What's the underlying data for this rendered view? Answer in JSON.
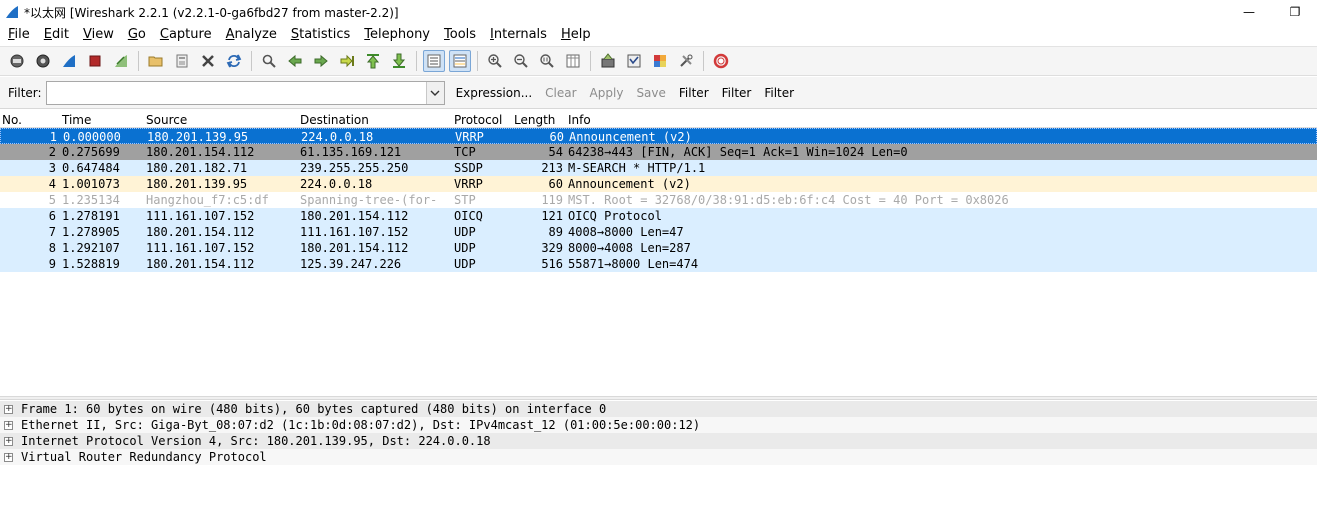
{
  "window": {
    "title": "*以太网 [Wireshark 2.2.1 (v2.2.1-0-ga6fbd27 from master-2.2)]",
    "minimize_glyph": "—",
    "restore_glyph": "❐"
  },
  "menu": [
    "File",
    "Edit",
    "View",
    "Go",
    "Capture",
    "Analyze",
    "Statistics",
    "Telephony",
    "Tools",
    "Internals",
    "Help"
  ],
  "toolbar": {
    "icons": [
      "interfaces-icon",
      "options-icon",
      "start-capture-icon",
      "stop-capture-icon",
      "restart-capture-icon",
      "open-file-icon",
      "save-file-icon",
      "close-file-icon",
      "reload-icon",
      "find-packet-icon",
      "go-back-icon",
      "go-forward-icon",
      "go-to-packet-icon",
      "first-packet-icon",
      "last-packet-icon",
      "autoscroll-icon",
      "colorize-icon",
      "zoom-in-icon",
      "zoom-out-icon",
      "zoom-normal-icon",
      "resize-columns-icon",
      "capture-filters-icon",
      "display-filters-icon",
      "coloring-rules-icon",
      "preferences-icon",
      "help-icon"
    ]
  },
  "filter": {
    "label": "Filter:",
    "value": "",
    "buttons": {
      "expression": "Expression...",
      "clear": "Clear",
      "apply": "Apply",
      "save": "Save",
      "filter1": "Filter",
      "filter2": "Filter",
      "filter3": "Filter"
    }
  },
  "packet_list": {
    "columns": [
      "No.",
      "Time",
      "Source",
      "Destination",
      "Protocol",
      "Length",
      "Info"
    ],
    "rows": [
      {
        "no": "1",
        "time": "0.000000",
        "src": "180.201.139.95",
        "dst": "224.0.0.18",
        "proto": "VRRP",
        "len": "60",
        "info": "Announcement (v2)"
      },
      {
        "no": "2",
        "time": "0.275699",
        "src": "180.201.154.112",
        "dst": "61.135.169.121",
        "proto": "TCP",
        "len": "54",
        "info": "64238→443 [FIN, ACK] Seq=1 Ack=1 Win=1024 Len=0"
      },
      {
        "no": "3",
        "time": "0.647484",
        "src": "180.201.182.71",
        "dst": "239.255.255.250",
        "proto": "SSDP",
        "len": "213",
        "info": "M-SEARCH * HTTP/1.1"
      },
      {
        "no": "4",
        "time": "1.001073",
        "src": "180.201.139.95",
        "dst": "224.0.0.18",
        "proto": "VRRP",
        "len": "60",
        "info": "Announcement (v2)"
      },
      {
        "no": "5",
        "time": "1.235134",
        "src": "Hangzhou_f7:c5:df",
        "dst": "Spanning-tree-(for-",
        "proto": "STP",
        "len": "119",
        "info": "MST. Root = 32768/0/38:91:d5:eb:6f:c4  Cost = 40  Port = 0x8026"
      },
      {
        "no": "6",
        "time": "1.278191",
        "src": "111.161.107.152",
        "dst": "180.201.154.112",
        "proto": "OICQ",
        "len": "121",
        "info": "OICQ Protocol"
      },
      {
        "no": "7",
        "time": "1.278905",
        "src": "180.201.154.112",
        "dst": "111.161.107.152",
        "proto": "UDP",
        "len": "89",
        "info": "4008→8000 Len=47"
      },
      {
        "no": "8",
        "time": "1.292107",
        "src": "111.161.107.152",
        "dst": "180.201.154.112",
        "proto": "UDP",
        "len": "329",
        "info": "8000→4008 Len=287"
      },
      {
        "no": "9",
        "time": "1.528819",
        "src": "180.201.154.112",
        "dst": "125.39.247.226",
        "proto": "UDP",
        "len": "516",
        "info": "55871→8000 Len=474"
      }
    ]
  },
  "packet_details": {
    "expander_glyph": "+",
    "rows": [
      "Frame 1: 60 bytes on wire (480 bits), 60 bytes captured (480 bits) on interface 0",
      "Ethernet II, Src: Giga-Byt_08:07:d2 (1c:1b:0d:08:07:d2), Dst: IPv4mcast_12 (01:00:5e:00:00:12)",
      "Internet Protocol Version 4, Src: 180.201.139.95, Dst: 224.0.0.18",
      "Virtual Router Redundancy Protocol"
    ]
  },
  "colors": {
    "selected_row": "#0a71d1",
    "tcp_row": "#a0a0a0",
    "udp_row": "#daeeff",
    "vrrp_row": "#fff3d6",
    "stp_text": "#a9a9a9"
  }
}
